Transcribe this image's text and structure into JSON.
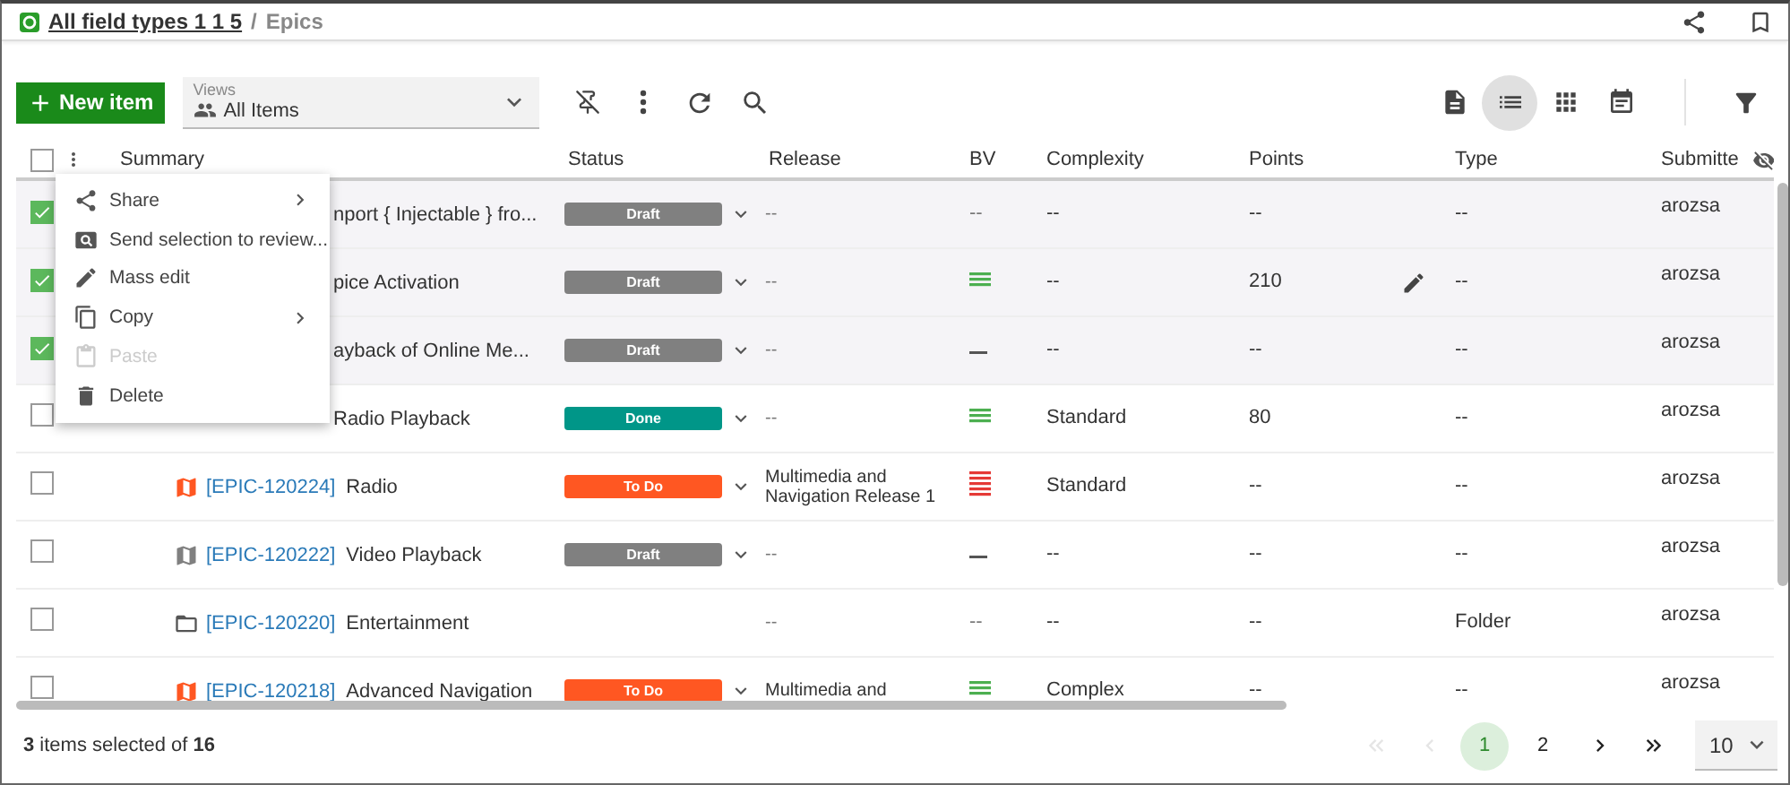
{
  "breadcrumb": {
    "project": "All field types 1 1 5",
    "separator": "/",
    "page": "Epics"
  },
  "toolbar": {
    "new_button": "New item",
    "views": {
      "label": "Views",
      "value": "All Items"
    },
    "view_modes": [
      {
        "kind": "document",
        "selected": false
      },
      {
        "kind": "list",
        "selected": true
      },
      {
        "kind": "grid",
        "selected": false
      },
      {
        "kind": "calendar",
        "selected": false
      }
    ]
  },
  "table": {
    "select_all": {
      "checked": false
    },
    "columns": [
      "Summary",
      "Status",
      "Release",
      "BV",
      "Complexity",
      "Points",
      "Type",
      "Submitte"
    ],
    "rows": [
      {
        "selected": true,
        "hovered": false,
        "title": "nport { Injectable } fro...",
        "status": {
          "label": "Draft",
          "color": "#808080"
        },
        "release": "--",
        "bv": {
          "kind": "text",
          "text": "--"
        },
        "complexity": "--",
        "points": "--",
        "type": "--",
        "submitter": "arozsa"
      },
      {
        "selected": true,
        "hovered": true,
        "title": "pice Activation",
        "status": {
          "label": "Draft",
          "color": "#808080"
        },
        "release": "--",
        "bv": {
          "kind": "medium"
        },
        "complexity": "--",
        "points": "210",
        "type": "--",
        "submitter": "arozsa"
      },
      {
        "selected": true,
        "hovered": false,
        "title": "ayback of Online Me...",
        "status": {
          "label": "Draft",
          "color": "#808080"
        },
        "release": "--",
        "bv": {
          "kind": "low"
        },
        "complexity": "--",
        "points": "--",
        "type": "--",
        "submitter": "arozsa"
      },
      {
        "selected": false,
        "hovered": false,
        "title": "Radio Playback",
        "status": {
          "label": "Done",
          "color": "#009688"
        },
        "release": "--",
        "bv": {
          "kind": "medium"
        },
        "complexity": "Standard",
        "points": "80",
        "type": "--",
        "submitter": "arozsa"
      },
      {
        "selected": false,
        "hovered": false,
        "item": {
          "kind": "epic",
          "color": "#ff5722"
        },
        "id": "[EPIC-120224]",
        "title": "Radio",
        "status": {
          "label": "To Do",
          "color": "#ff5722"
        },
        "release": "Multimedia and Navigation Release 1",
        "bv": {
          "kind": "high"
        },
        "complexity": "Standard",
        "points": "--",
        "type": "--",
        "submitter": "arozsa"
      },
      {
        "selected": false,
        "hovered": false,
        "item": {
          "kind": "epic",
          "color": "#808080"
        },
        "id": "[EPIC-120222]",
        "title": "Video Playback",
        "status": {
          "label": "Draft",
          "color": "#808080"
        },
        "release": "--",
        "bv": {
          "kind": "low"
        },
        "complexity": "--",
        "points": "--",
        "type": "--",
        "submitter": "arozsa"
      },
      {
        "selected": false,
        "hovered": false,
        "item": {
          "kind": "folder"
        },
        "id": "[EPIC-120220]",
        "title": "Entertainment",
        "release": "--",
        "bv": {
          "kind": "text",
          "text": "--"
        },
        "complexity": "--",
        "points": "--",
        "type": "Folder",
        "submitter": "arozsa"
      },
      {
        "selected": false,
        "hovered": false,
        "item": {
          "kind": "epic",
          "color": "#ff5722"
        },
        "id": "[EPIC-120218]",
        "title": "Advanced Navigation",
        "status": {
          "label": "To Do",
          "color": "#ff5722"
        },
        "release": "Multimedia and",
        "bv": {
          "kind": "medium"
        },
        "complexity": "Complex",
        "points": "--",
        "type": "--",
        "submitter": "arozsa"
      }
    ]
  },
  "context_menu": [
    {
      "kind": "share",
      "label": "Share",
      "submenu": true,
      "disabled": false
    },
    {
      "kind": "review",
      "label": "Send selection to review...",
      "submenu": false,
      "disabled": false
    },
    {
      "kind": "edit",
      "label": "Mass edit",
      "submenu": false,
      "disabled": false
    },
    {
      "kind": "copy",
      "label": "Copy",
      "submenu": true,
      "disabled": false
    },
    {
      "kind": "paste",
      "label": "Paste",
      "submenu": false,
      "disabled": true
    },
    {
      "kind": "delete",
      "label": "Delete",
      "submenu": false,
      "disabled": false
    }
  ],
  "footer": {
    "selection": "**3** items selected of **16**",
    "nav": [
      {
        "kind": "first",
        "disabled": true
      },
      {
        "kind": "prev",
        "disabled": true
      },
      {
        "kind": "next",
        "disabled": false
      },
      {
        "kind": "last",
        "disabled": false
      }
    ],
    "pages": [
      {
        "label": "1",
        "selected": true
      },
      {
        "label": "2",
        "selected": false
      }
    ],
    "page_size": "10"
  }
}
